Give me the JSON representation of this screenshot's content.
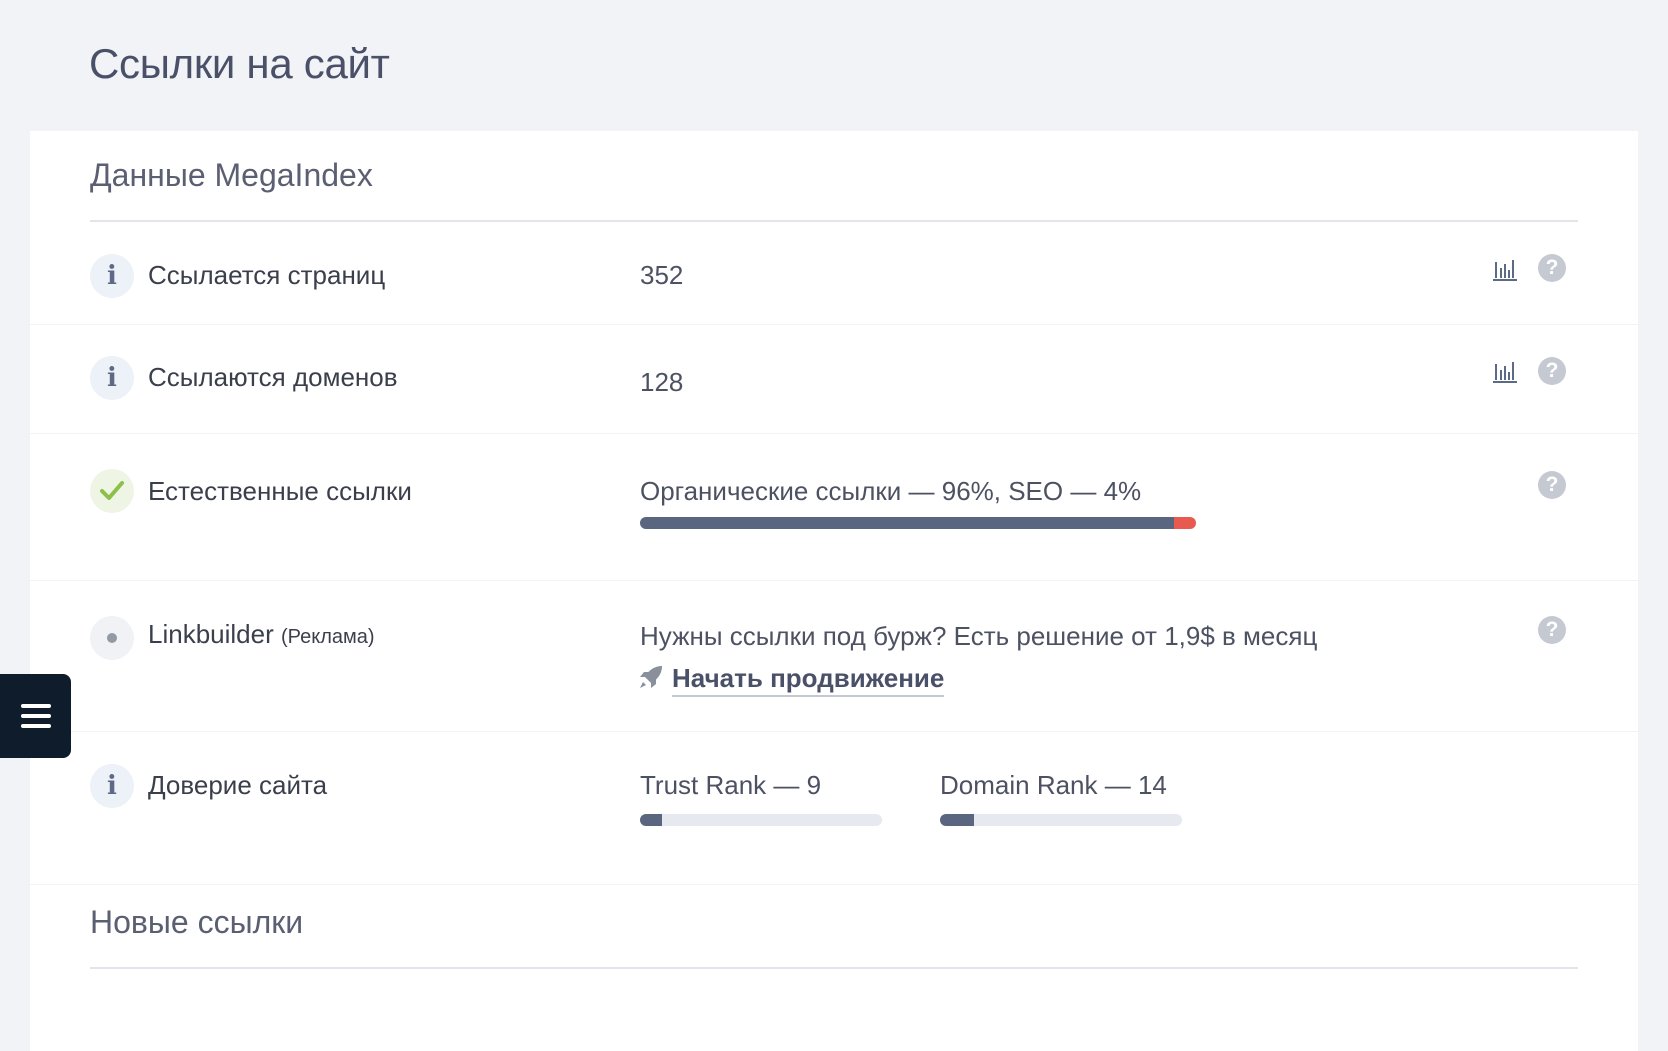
{
  "page": {
    "title": "Ссылки на сайт"
  },
  "section_megaindex": {
    "title": "Данные MegaIndex"
  },
  "rows": {
    "pages": {
      "label": "Ссылается страниц",
      "value": "352"
    },
    "domains": {
      "label": "Ссылаются доменов",
      "value": "128"
    },
    "natural": {
      "label": "Естественные ссылки",
      "value": "Органические ссылки — 96%, SEO — 4%",
      "organic_percent": 96,
      "seo_percent": 4
    },
    "linkbuilder": {
      "label": "Linkbuilder",
      "label_note": "(Реклама)",
      "text": "Нужны ссылки под бурж? Есть решение от 1,9$ в месяц",
      "link_label": "Начать продвижение"
    },
    "trust": {
      "label": "Доверие сайта",
      "trust_rank_label": "Trust Rank — 9",
      "trust_rank_value": 9,
      "domain_rank_label": "Domain Rank — 14",
      "domain_rank_value": 14
    }
  },
  "section_new_links": {
    "title": "Новые ссылки"
  },
  "colors": {
    "background": "#f1f3f7",
    "bar_fill": "#5a6680",
    "bar_seo": "#e85a4f",
    "check": "#8cc04a",
    "menu_button": "#0e1c2b"
  },
  "icons": [
    "info-icon",
    "check-icon",
    "dot-icon",
    "chart-icon",
    "help-icon",
    "rocket-icon",
    "menu-icon"
  ]
}
